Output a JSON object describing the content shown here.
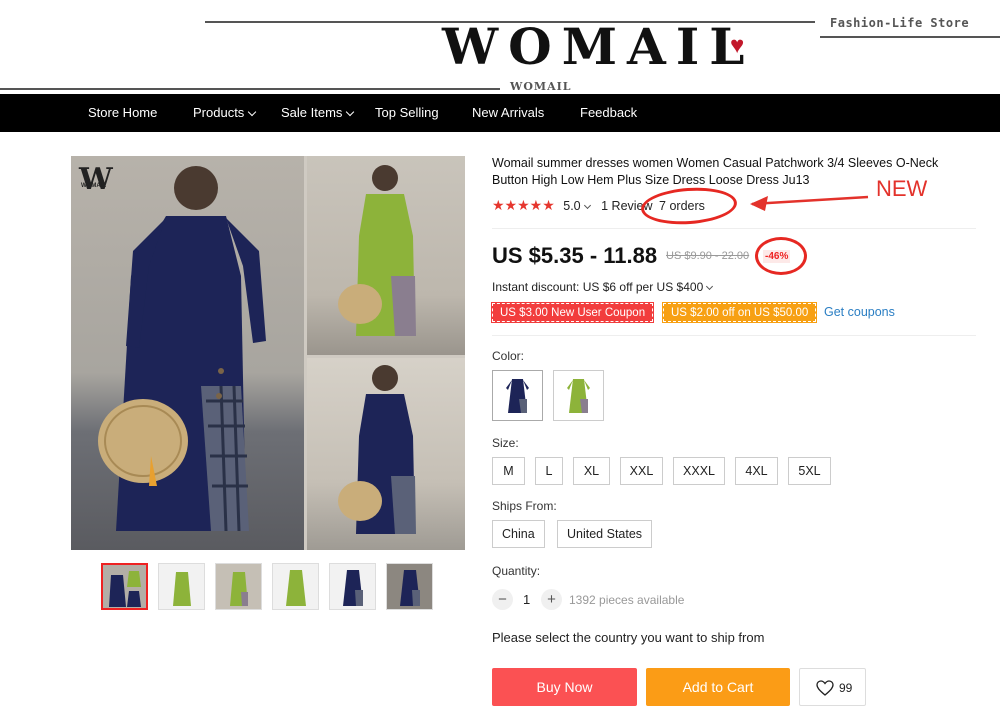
{
  "header": {
    "logo": "WOMAIL",
    "logo_sub": "WOMAIL",
    "tagline": "Fashion-Life Store"
  },
  "nav": {
    "items": [
      {
        "label": "Store Home",
        "dropdown": false
      },
      {
        "label": "Products",
        "dropdown": true
      },
      {
        "label": "Sale Items",
        "dropdown": true
      },
      {
        "label": "Top Selling",
        "dropdown": false
      },
      {
        "label": "New Arrivals",
        "dropdown": false
      },
      {
        "label": "Feedback",
        "dropdown": false
      }
    ]
  },
  "gallery": {
    "brand_mark": "W",
    "brand_mark_small": "WOMAIL",
    "thumbnails": [
      {
        "color": "navy+green",
        "selected": true
      },
      {
        "color": "green",
        "selected": false
      },
      {
        "color": "green",
        "selected": false
      },
      {
        "color": "green",
        "selected": false
      },
      {
        "color": "navy",
        "selected": false
      },
      {
        "color": "navy",
        "selected": false
      }
    ]
  },
  "product": {
    "title": "Womail summer dresses women Women Casual Patchwork 3/4 Sleeves O-Neck Button High Low Hem Plus Size Dress Loose Dress Ju13",
    "rating": "5.0",
    "reviews": "1 Review",
    "orders": "7 orders",
    "annotation": "NEW",
    "price": "US $5.35 - 11.88",
    "original_price": "US $9.90 - 22.00",
    "discount": "-46%",
    "instant_discount": "Instant discount: US $6 off per US $400",
    "coupons": [
      "US $3.00 New User Coupon",
      "US $2.00 off on US $50.00"
    ],
    "get_coupons": "Get coupons",
    "color_label": "Color:",
    "colors": [
      "navy",
      "green"
    ],
    "size_label": "Size:",
    "sizes": [
      "M",
      "L",
      "XL",
      "XXL",
      "XXXL",
      "4XL",
      "5XL"
    ],
    "ships_from_label": "Ships From:",
    "ships_from": [
      "China",
      "United States"
    ],
    "quantity_label": "Quantity:",
    "quantity": "1",
    "available": "1392 pieces available",
    "ship_note": "Please select the country you want to ship from",
    "buy_now": "Buy Now",
    "add_to_cart": "Add to Cart",
    "wishlist_count": "99"
  },
  "colors": {
    "accent_red": "#e62822",
    "buy_button": "#fb5153",
    "cart_button": "#fb9c16",
    "link": "#2a7ec3",
    "nav_bg": "#000000"
  }
}
